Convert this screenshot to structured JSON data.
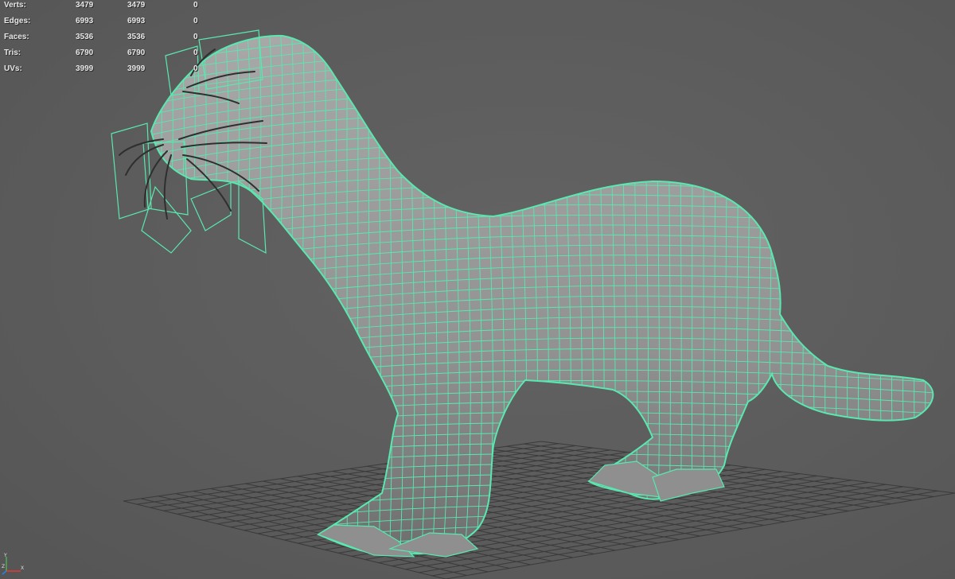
{
  "hud": {
    "rows": [
      {
        "label": "Verts:",
        "c1": "3479",
        "c2": "3479",
        "c3": "0"
      },
      {
        "label": "Edges:",
        "c1": "6993",
        "c2": "6993",
        "c3": "0"
      },
      {
        "label": "Faces:",
        "c1": "3536",
        "c2": "3536",
        "c3": "0"
      },
      {
        "label": "Tris:",
        "c1": "6790",
        "c2": "6790",
        "c3": "0"
      },
      {
        "label": "UVs:",
        "c1": "3999",
        "c2": "3999",
        "c3": "0"
      }
    ]
  },
  "gizmo": {
    "y": "Y",
    "z": "Z",
    "x": "X"
  },
  "colors": {
    "wire": "#59e8b0",
    "body": "#9a9a9a",
    "grid": "#3a3a3a",
    "background": "#5b5b5b",
    "whisker": "#2f2f2f"
  }
}
